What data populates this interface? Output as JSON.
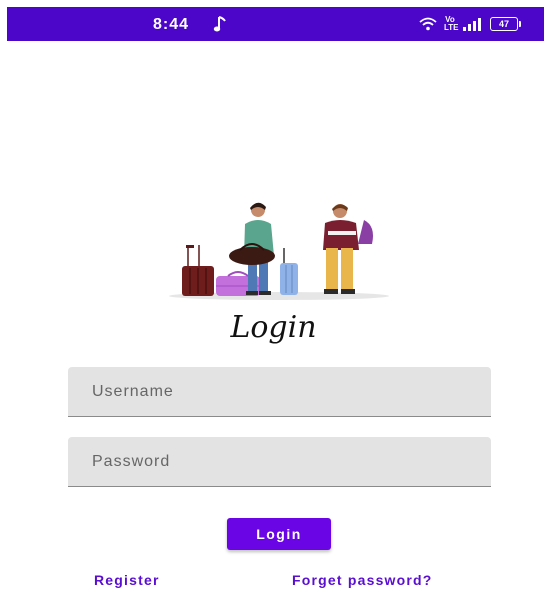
{
  "status_bar": {
    "time": "8:44",
    "volte": "Vo LTE",
    "battery": "47",
    "background": "#4b06c9"
  },
  "login": {
    "title": "Login",
    "username_placeholder": "Username",
    "password_placeholder": "Password",
    "button_label": "Login",
    "register_label": "Register",
    "forget_label": "Forget password?"
  },
  "colors": {
    "accent": "#6a05e6",
    "link": "#5a0ed0",
    "field_bg": "#e3e3e3"
  },
  "icons": [
    "music-note-icon",
    "wifi-icon",
    "volte-icon",
    "signal-icon",
    "battery-icon"
  ]
}
